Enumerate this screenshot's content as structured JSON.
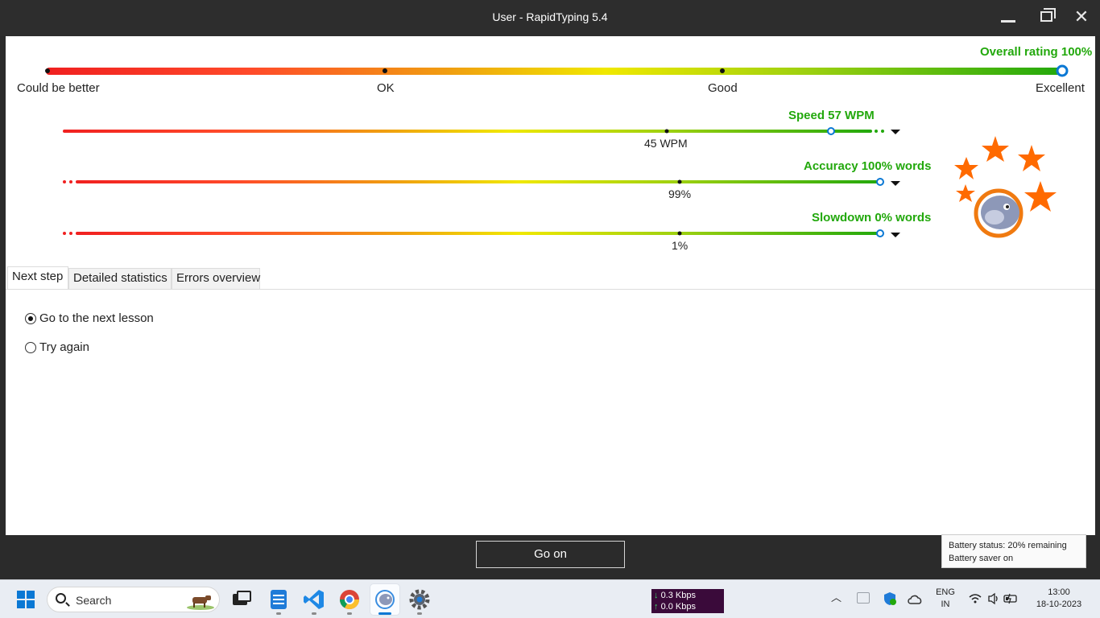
{
  "window": {
    "title": "User - RapidTyping 5.4"
  },
  "overall": {
    "label": "Overall rating 100%",
    "ticks": [
      "Could be better",
      "OK",
      "Good",
      "Excellent"
    ],
    "value_percent": 100
  },
  "speed": {
    "label": "Speed 57 WPM",
    "marker_label": "45 WPM"
  },
  "accuracy": {
    "label": "Accuracy 100% words",
    "marker_label": "99%"
  },
  "slowdown": {
    "label": "Slowdown 0% words",
    "marker_label": "1%"
  },
  "tabs": [
    {
      "label": "Next step",
      "active": true
    },
    {
      "label": "Detailed statistics",
      "active": false
    },
    {
      "label": "Errors overview",
      "active": false
    }
  ],
  "next_step": {
    "options": [
      {
        "label": "Go to the next lesson",
        "checked": true
      },
      {
        "label": "Try again",
        "checked": false
      }
    ]
  },
  "footer": {
    "go_on_label": "Go on"
  },
  "tooltip": {
    "line1": "Battery status: 20% remaining",
    "line2": "Battery saver on"
  },
  "taskbar": {
    "search_label": "Search",
    "net_down": "0.3 Kbps",
    "net_up": "0.0 Kbps",
    "lang_line1": "ENG",
    "lang_line2": "IN",
    "time": "13:00",
    "date": "18-10-2023"
  },
  "colors": {
    "green": "#22a80c",
    "accent_blue": "#0a78d4",
    "star_orange": "#ff6a00"
  }
}
